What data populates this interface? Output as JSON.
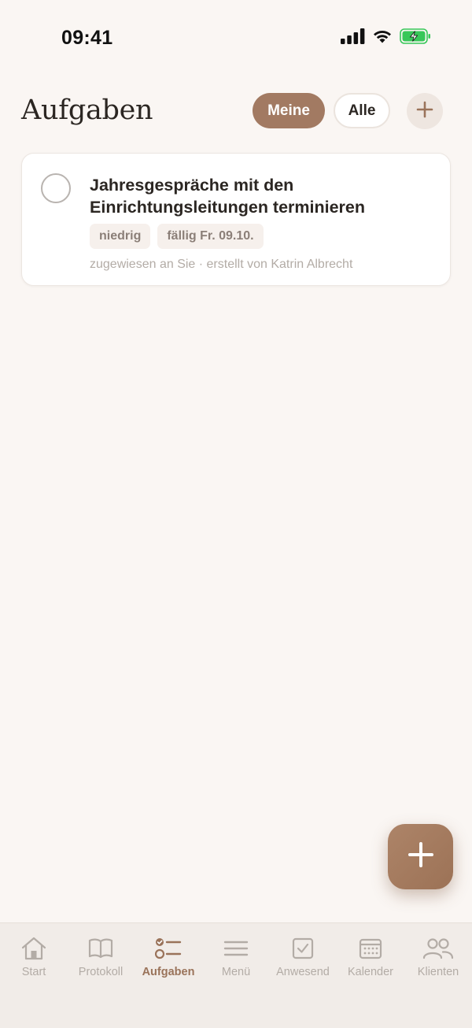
{
  "status_bar": {
    "time": "09:41",
    "icons": [
      "cellular-signal-icon",
      "wifi-icon",
      "battery-charging-icon"
    ]
  },
  "header": {
    "title": "Aufgaben",
    "filters": [
      {
        "label": "Meine",
        "selected": true
      },
      {
        "label": "Alle",
        "selected": false
      }
    ],
    "add_icon": "plus-icon"
  },
  "tasks": [
    {
      "title": "Jahresgespräche mit den Einrichtungsleitungen terminieren",
      "done": false,
      "tags": [
        "niedrig",
        "fällig Fr. 09.10."
      ],
      "meta": "zugewiesen an Sie · erstellt von Katrin Albrecht"
    }
  ],
  "fab": {
    "icon": "plus-icon"
  },
  "tab_bar": {
    "items": [
      {
        "label": "Start",
        "icon": "home-icon",
        "active": false
      },
      {
        "label": "Protokoll",
        "icon": "book-icon",
        "active": false
      },
      {
        "label": "Aufgaben",
        "icon": "task-list-icon",
        "active": true
      },
      {
        "label": "Menü",
        "icon": "menu-icon",
        "active": false
      },
      {
        "label": "Anwesend",
        "icon": "checkbox-icon",
        "active": false
      },
      {
        "label": "Kalender",
        "icon": "calendar-icon",
        "active": false
      },
      {
        "label": "Klienten",
        "icon": "people-icon",
        "active": false
      }
    ]
  },
  "colors": {
    "background": "#faf6f3",
    "accent": "#a27a62",
    "active_tab": "#9a735a",
    "muted_text": "#b3aca6"
  }
}
